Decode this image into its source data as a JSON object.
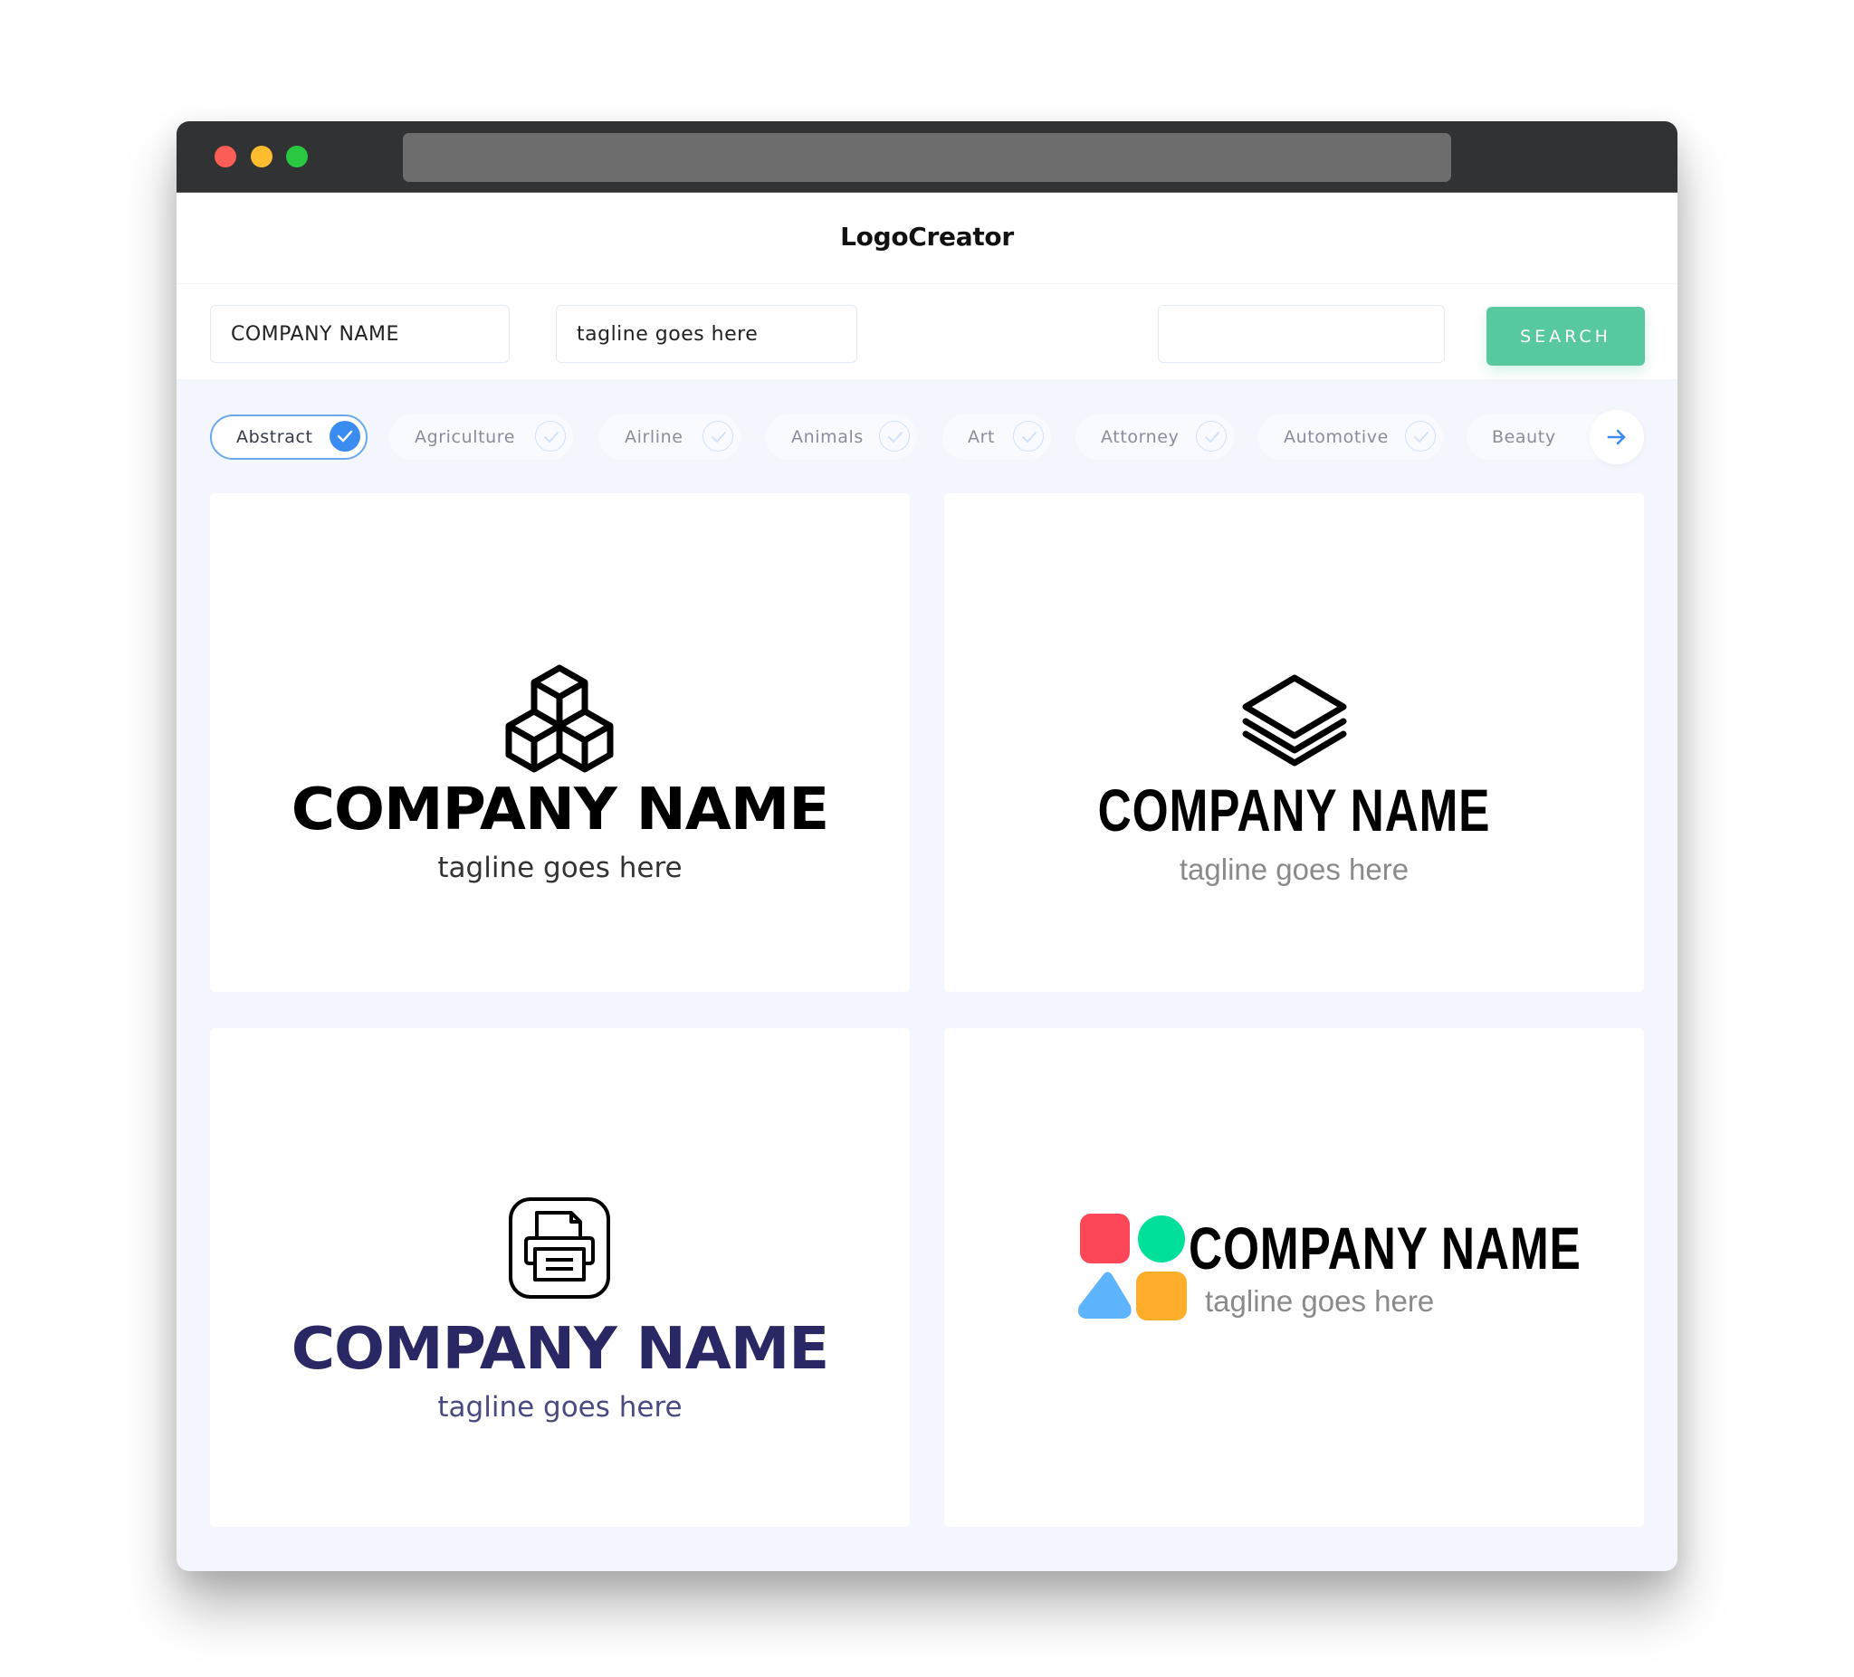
{
  "app": {
    "title": "LogoCreator"
  },
  "search": {
    "company_name_value": "COMPANY NAME",
    "tagline_value": "tagline goes here",
    "keyword_value": "",
    "search_label": "SEARCH"
  },
  "categories": [
    {
      "label": "Abstract",
      "selected": true
    },
    {
      "label": "Agriculture",
      "selected": false
    },
    {
      "label": "Airline",
      "selected": false
    },
    {
      "label": "Animals",
      "selected": false
    },
    {
      "label": "Art",
      "selected": false
    },
    {
      "label": "Attorney",
      "selected": false
    },
    {
      "label": "Automotive",
      "selected": false
    },
    {
      "label": "Beauty",
      "selected": false
    }
  ],
  "logos": [
    {
      "icon": "cubes-icon",
      "name": "COMPANY NAME",
      "tagline": "tagline goes here",
      "name_color": "#000000",
      "tagline_color": "#333333"
    },
    {
      "icon": "layers-icon",
      "name": "COMPANY NAME",
      "tagline": "tagline goes here",
      "name_color": "#000000",
      "tagline_color": "#8a8a8a"
    },
    {
      "icon": "printer-icon",
      "name": "COMPANY NAME",
      "tagline": "tagline goes here",
      "name_color": "#2a2864",
      "tagline_color": "#4a4a82"
    },
    {
      "icon": "colorful-shapes-icon",
      "name": "COMPANY NAME",
      "tagline": "tagline goes here",
      "name_color": "#000000",
      "tagline_color": "#8a8a8a"
    }
  ],
  "colors": {
    "accent_green": "#58c89f",
    "accent_blue": "#3b8cf0",
    "shape_red": "#fd4657",
    "shape_green": "#00e09a",
    "shape_blue": "#5eb4fd",
    "shape_orange": "#feae2a"
  }
}
